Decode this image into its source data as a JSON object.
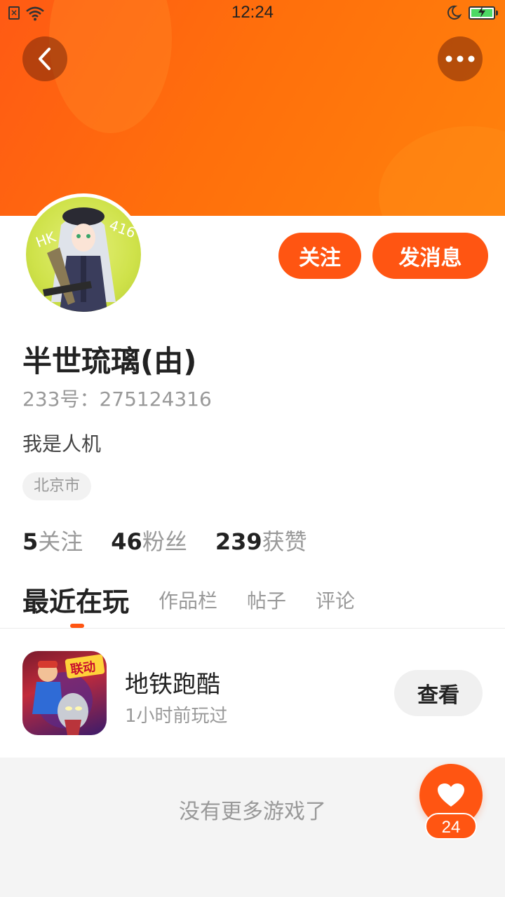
{
  "status_bar": {
    "time": "12:24",
    "icons": [
      "sim-icon",
      "wifi-icon",
      "moon-icon",
      "battery-charging-icon"
    ]
  },
  "header": {
    "back_icon": "chevron-left-icon",
    "more_icon": "more-dots-icon",
    "gradient_colors": [
      "#ff5a14",
      "#ff820c"
    ]
  },
  "profile": {
    "avatar_text": [
      "HK",
      "416"
    ],
    "username": "半世琉璃(由)",
    "user_id": "233号：275124316",
    "bio": "我是人机",
    "location": "北京市",
    "follow_label": "关注",
    "message_label": "发消息",
    "stats": [
      {
        "count": "5",
        "label": "关注"
      },
      {
        "count": "46",
        "label": "粉丝"
      },
      {
        "count": "239",
        "label": "获赞"
      }
    ]
  },
  "tabs": [
    {
      "label": "最近在玩",
      "active": true
    },
    {
      "label": "作品栏",
      "active": false
    },
    {
      "label": "帖子",
      "active": false
    },
    {
      "label": "评论",
      "active": false
    }
  ],
  "games": [
    {
      "title": "地铁跑酷",
      "subtitle": "1小时前玩过",
      "button_label": "查看",
      "icon_badge": "联动"
    }
  ],
  "footer": {
    "no_more_text": "没有更多游戏了",
    "like_count": "24",
    "like_icon": "heart-icon"
  },
  "colors": {
    "accent": "#ff5512",
    "text_primary": "#222222",
    "text_secondary": "#999999"
  }
}
